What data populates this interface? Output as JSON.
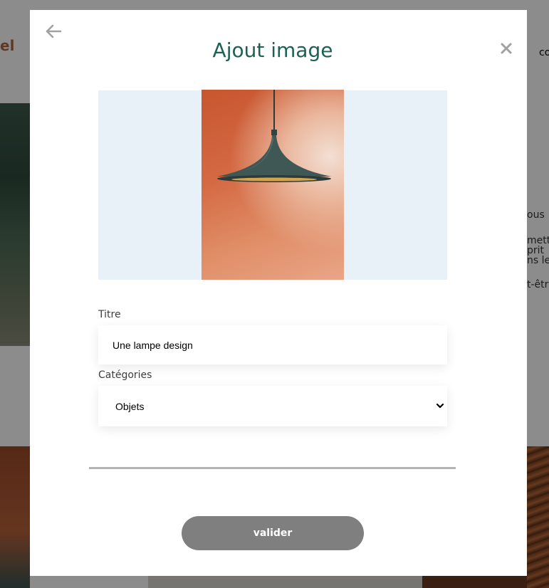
{
  "background": {
    "logo": "el",
    "nav_fragment": "co",
    "text_fragments": [
      "ous",
      "mett",
      "prit",
      "ns le",
      "t-êtr"
    ]
  },
  "modal": {
    "title": "Ajout image",
    "back_icon": "arrow-left-icon",
    "close_icon": "close-icon",
    "form": {
      "title_label": "Titre",
      "title_value": "Une lampe design",
      "category_label": "Catégories",
      "category_selected": "Objets",
      "submit_label": "valider"
    }
  },
  "colors": {
    "title": "#1d6154",
    "button_disabled": "#7f7f7f",
    "preview_bg": "#e8f0f8",
    "divider": "#b3b3b3"
  }
}
